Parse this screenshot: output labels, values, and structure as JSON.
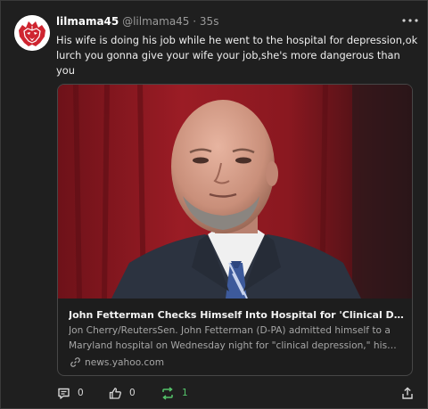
{
  "post": {
    "username": "lilmama45",
    "handle": "@lilmama45",
    "separator": "·",
    "time": "35s",
    "text": "His wife is doing his job while he went to the hospital for depression,ok lurch you gonna give your wife your job,she's more dangerous than you"
  },
  "link_card": {
    "title": "John Fetterman Checks Himself Into Hospital for 'Clinical Depression'",
    "description": "Jon Cherry/ReutersSen. John Fetterman (D-PA) admitted himself to a Maryland hospital on Wednesday night for \"clinical depression,\" his office said.",
    "domain": "news.yahoo.com"
  },
  "actions": {
    "reply_count": "0",
    "like_count": "0",
    "repost_count": "1"
  },
  "colors": {
    "background": "#1f1f1f",
    "repost_active": "#55c46a",
    "avatar_red": "#cf2530"
  },
  "icons": [
    "lion-logo-icon",
    "more-dots-icon",
    "link-icon",
    "reply-icon",
    "like-icon",
    "repost-icon",
    "share-icon"
  ]
}
